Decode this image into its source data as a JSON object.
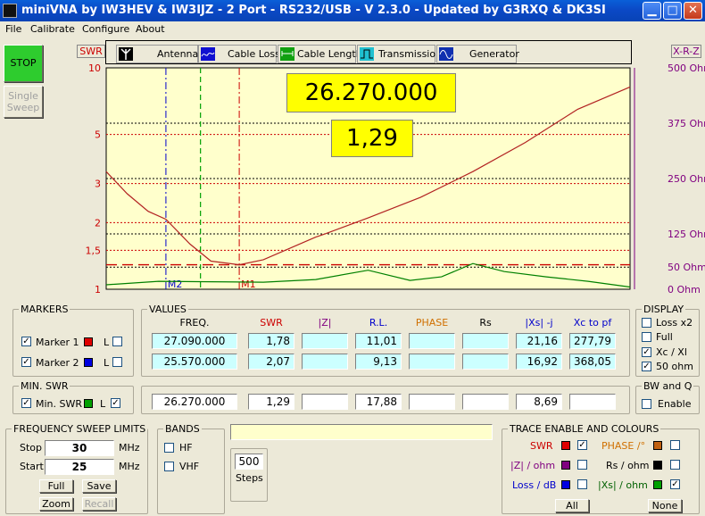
{
  "window": {
    "title": "miniVNA by IW3HEV & IW3IJZ - 2 Port - RS232/USB - V 2.3.0 - Updated by G3RXQ & DK3SI"
  },
  "menu": [
    "File",
    "Calibrate",
    "Configure",
    "About"
  ],
  "left_buttons": {
    "stop": "STOP",
    "single_sweep_1": "Single",
    "single_sweep_2": "Sweep"
  },
  "tabs": [
    {
      "label": "Antenna",
      "icon": "antenna-icon"
    },
    {
      "label": "Cable Loss",
      "icon": "cable-loss-icon"
    },
    {
      "label": "Cable Length",
      "icon": "cable-length-icon"
    },
    {
      "label": "Transmission",
      "icon": "transmission-icon"
    },
    {
      "label": "Generator",
      "icon": "generator-icon"
    }
  ],
  "axis": {
    "left_title": "SWR",
    "right_title": "X-R-Z"
  },
  "chart_data": {
    "type": "line",
    "left_axis": {
      "label": "SWR",
      "scale": "log",
      "range": [
        1,
        10
      ],
      "ticks": [
        "10",
        "5",
        "3",
        "2",
        "1,5",
        "1"
      ]
    },
    "right_axis": {
      "label": "X-R-Z",
      "range": [
        0,
        500
      ],
      "ticks": [
        "500 Ohm",
        "375 Ohm",
        "250 Ohm",
        "125 Ohm",
        "50 Ohm",
        "0 Ohm"
      ]
    },
    "x_range_mhz": [
      25,
      30
    ],
    "series": [
      {
        "color": "#b22222",
        "x": [
          25.0,
          25.2,
          25.4,
          25.57,
          25.8,
          26.0,
          26.27,
          26.5,
          27.0,
          27.09,
          27.5,
          28.0,
          28.5,
          29.0,
          29.5,
          30.0
        ],
        "y": [
          3.4,
          2.7,
          2.25,
          2.07,
          1.6,
          1.34,
          1.29,
          1.36,
          1.72,
          1.78,
          2.1,
          2.6,
          3.4,
          4.6,
          6.5,
          8.2
        ]
      },
      {
        "color": "#008000",
        "x": [
          25.0,
          25.5,
          26.0,
          26.5,
          27.0,
          27.5,
          27.9,
          28.2,
          28.5,
          28.8,
          29.2,
          29.6,
          30.0
        ],
        "y": [
          10,
          18,
          17,
          16,
          22,
          43,
          20,
          28,
          58,
          40,
          28,
          18,
          5
        ]
      }
    ],
    "markers": [
      {
        "name": "M2",
        "freq": 25.57,
        "color": "#0000cc"
      },
      {
        "name": "M1",
        "freq": 26.27,
        "color": "#cc0000"
      }
    ],
    "cursor_freq": 25.9,
    "min_swr_line": 1.29,
    "readout": {
      "freq": "26.270.000",
      "swr": "1,29"
    }
  },
  "markers_panel": {
    "title": "MARKERS",
    "m1": "Marker 1",
    "m2": "Marker 2",
    "l": "L"
  },
  "minswr": {
    "title": "MIN. SWR",
    "label": "Min. SWR",
    "l": "L"
  },
  "values": {
    "title": "VALUES",
    "headers": [
      "FREQ.",
      "SWR",
      "|Z|",
      "R.L.",
      "PHASE",
      "Rs",
      "|Xs| -j",
      "Xc to pf"
    ],
    "m1": [
      "27.090.000",
      "1,78",
      "",
      "11,01",
      "",
      "",
      "21,16",
      "277,79"
    ],
    "m2": [
      "25.570.000",
      "2,07",
      "",
      "9,13",
      "",
      "",
      "16,92",
      "368,05"
    ],
    "min": [
      "26.270.000",
      "1,29",
      "",
      "17,88",
      "",
      "",
      "8,69",
      ""
    ]
  },
  "display": {
    "title": "DISPLAY",
    "items": [
      "Loss x2",
      "Full",
      "Xc / Xl",
      "50 ohm"
    ],
    "checked": [
      "",
      "",
      "✓",
      "✓"
    ]
  },
  "bwq": {
    "title": "BW and Q",
    "enable": "Enable"
  },
  "sweep": {
    "title": "FREQUENCY SWEEP LIMITS",
    "stop_label": "Stop",
    "start_label": "Start",
    "stop": "30",
    "start": "25",
    "unit": "MHz",
    "full": "Full",
    "save": "Save",
    "zoom": "Zoom",
    "recall": "Recall"
  },
  "bands": {
    "title": "BANDS",
    "hf": "HF",
    "vhf": "VHF"
  },
  "steps": {
    "value": "500",
    "label": "Steps"
  },
  "trace": {
    "title": "TRACE ENABLE AND COLOURS",
    "swr": "SWR",
    "z": "|Z| / ohm",
    "loss": "Loss / dB",
    "phase": "PHASE /°",
    "rs": "Rs / ohm",
    "xs": "|Xs| / ohm",
    "all": "All",
    "none": "None"
  }
}
